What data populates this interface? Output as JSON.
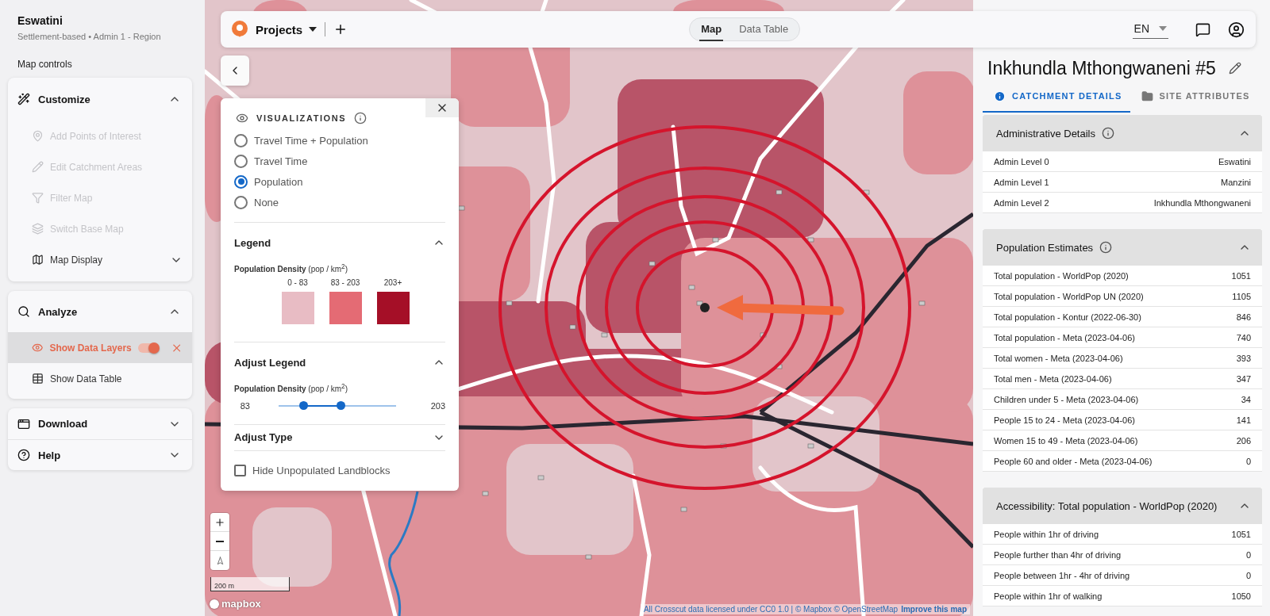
{
  "sidebar": {
    "title": "Eswatini",
    "subtitle": "Settlement-based • Admin 1 - Region",
    "section_label": "Map controls",
    "groups": [
      {
        "title": "Customize",
        "expanded": true,
        "items": [
          {
            "label": "Add Points of Interest",
            "disabled": true,
            "kind": "action"
          },
          {
            "label": "Edit Catchment Areas",
            "disabled": true,
            "kind": "action"
          },
          {
            "label": "Filter Map",
            "disabled": true,
            "kind": "action"
          },
          {
            "label": "Switch Base Map",
            "disabled": true,
            "kind": "action"
          },
          {
            "label": "Map Display",
            "disabled": false,
            "kind": "submenu",
            "expanded": false
          }
        ]
      },
      {
        "title": "Analyze",
        "expanded": true,
        "items": [
          {
            "label": "Show Data Layers",
            "disabled": false,
            "kind": "layer",
            "selected": true,
            "layer_on": true
          },
          {
            "label": "Show Data Table",
            "disabled": false,
            "kind": "action",
            "selected": false
          }
        ]
      },
      {
        "title": "Download",
        "expanded": false
      },
      {
        "title": "Help",
        "expanded": false
      }
    ]
  },
  "top_bar": {
    "projects": "Projects",
    "views": [
      {
        "label": "Map",
        "selected": true
      },
      {
        "label": "Data Table",
        "selected": false
      }
    ],
    "language": "EN"
  },
  "visualizations": {
    "title": "VISUALIZATIONS",
    "options": [
      {
        "label": "Travel Time + Population",
        "selected": false
      },
      {
        "label": "Travel Time",
        "selected": false
      },
      {
        "label": "Population",
        "selected": true
      },
      {
        "label": "None",
        "selected": false
      }
    ],
    "legend": {
      "title": "Legend",
      "expanded": true,
      "heading": "**Population Density** (pop / km$^{2}$)",
      "bins": [
        {
          "label": "0 - 83",
          "color": "#e8bcc4"
        },
        {
          "label": "83 - 203",
          "color": "#e46b74"
        },
        {
          "label": "203+",
          "color": "#a50f27"
        }
      ]
    },
    "adjust_legend": {
      "title": "Adjust Legend",
      "expanded": true,
      "heading": "**Population Density** (pop / km$^{2}$)",
      "min": "83",
      "max": "203",
      "thumbs": [
        {
          "level": 0.21
        },
        {
          "level": 0.53
        }
      ]
    },
    "adjust_type": {
      "title": "Adjust Type",
      "expanded": false
    },
    "hide_unpopulated": {
      "label": "Hide Unpopulated Landblocks",
      "checked": false
    }
  },
  "map": {
    "scale": "200 m",
    "logo": "mapbox",
    "attribution": "All Crosscut data licensed under CC0 1.0 | © Mapbox © OpenStreetMap",
    "improve_link": "Improve this map"
  },
  "details": {
    "title": "Inkhundla Mthongwaneni #5",
    "tabs": [
      {
        "label": "CATCHMENT DETAILS",
        "selected": true
      },
      {
        "label": "SITE ATTRIBUTES",
        "selected": false
      }
    ],
    "sections": [
      {
        "title": "Administrative Details",
        "info": true,
        "expanded": true,
        "rows": [
          {
            "label": "Admin Level 0",
            "value": "Eswatini"
          },
          {
            "label": "Admin Level 1",
            "value": "Manzini"
          },
          {
            "label": "Admin Level 2",
            "value": "Inkhundla Mthongwaneni"
          }
        ]
      },
      {
        "title": "Population Estimates",
        "info": true,
        "expanded": true,
        "rows": [
          {
            "label": "Total population - WorldPop (2020)",
            "value": "1051"
          },
          {
            "label": "Total population - WorldPop UN (2020)",
            "value": "1105"
          },
          {
            "label": "Total population - Kontur (2022-06-30)",
            "value": "846"
          },
          {
            "label": "Total population - Meta (2023-04-06)",
            "value": "740"
          },
          {
            "label": "Total women - Meta (2023-04-06)",
            "value": "393"
          },
          {
            "label": "Total men - Meta (2023-04-06)",
            "value": "347"
          },
          {
            "label": "Children under 5 - Meta (2023-04-06)",
            "value": "34"
          },
          {
            "label": "People 15 to 24 - Meta (2023-04-06)",
            "value": "141"
          },
          {
            "label": "Women 15 to 49 - Meta (2023-04-06)",
            "value": "206"
          },
          {
            "label": "People 60 and older - Meta (2023-04-06)",
            "value": "0"
          }
        ]
      },
      {
        "title": "Accessibility: Total population - WorldPop (2020)",
        "info": false,
        "expanded": true,
        "rows": [
          {
            "label": "People within 1hr of driving",
            "value": "1051"
          },
          {
            "label": "People further than 4hr of driving",
            "value": "0"
          },
          {
            "label": "People between 1hr - 4hr of driving",
            "value": "0"
          },
          {
            "label": "People within 1hr of walking",
            "value": "1050"
          }
        ]
      }
    ]
  }
}
